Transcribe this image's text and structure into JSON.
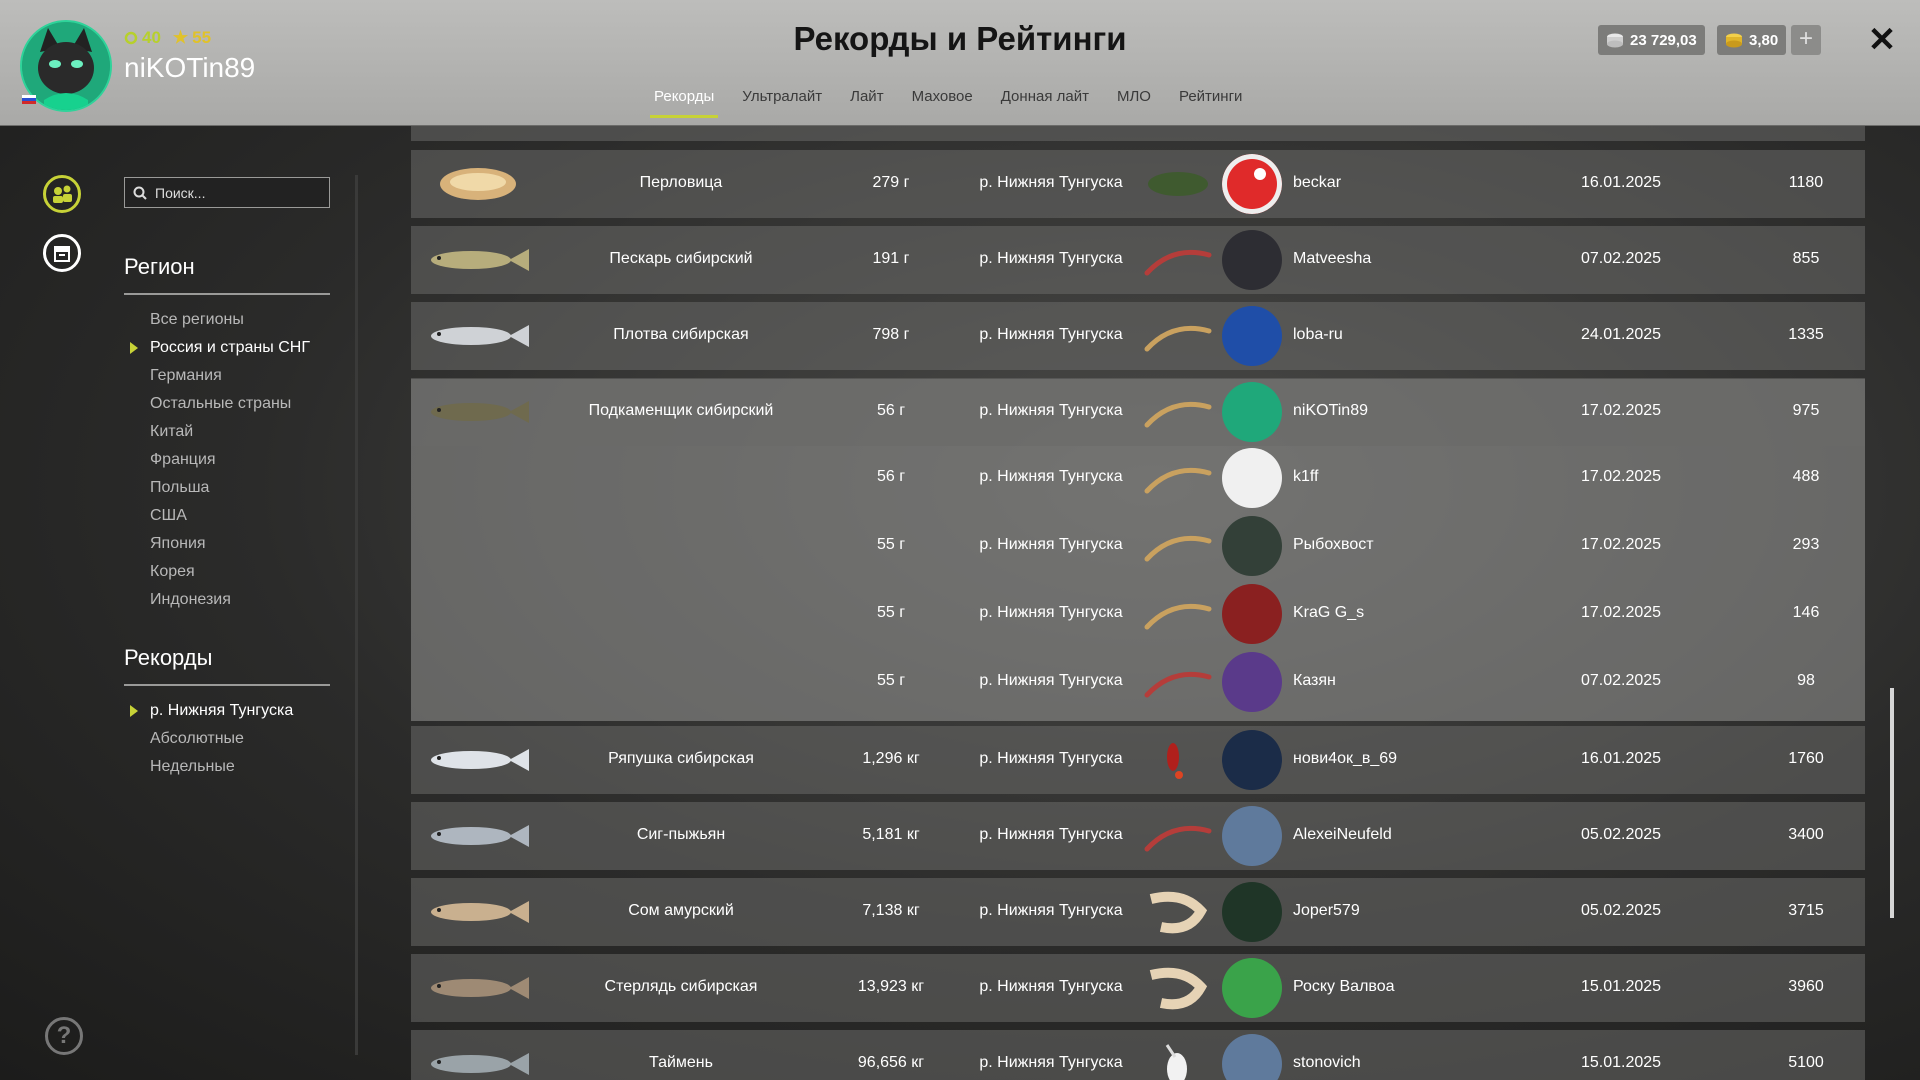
{
  "header": {
    "title": "Рекорды и Рейтинги",
    "username": "niKOTin89",
    "level": "40",
    "stars": "55",
    "silver": "23 729,03",
    "gold": "3,80",
    "plus": "+",
    "close": "✕",
    "tabs": [
      "Рекорды",
      "Ультралайт",
      "Лайт",
      "Маховое",
      "Донная лайт",
      "МЛО",
      "Рейтинги"
    ],
    "active_tab": "Рекорды"
  },
  "sidebar": {
    "search_placeholder": "Поиск...",
    "region_title": "Регион",
    "regions": [
      "Все регионы",
      "Россия и страны СНГ",
      "Германия",
      "Остальные страны",
      "Китай",
      "Франция",
      "Польша",
      "США",
      "Япония",
      "Корея",
      "Индонезия"
    ],
    "selected_region": "Россия и страны СНГ",
    "records_title": "Рекорды",
    "records": [
      "р. Нижняя Тунгуска",
      "Абсолютные",
      "Недельные"
    ],
    "selected_record": "р. Нижняя Тунгуска",
    "help": "?"
  },
  "rows": [
    {
      "fish": "Перловица",
      "weight": "279 г",
      "location": "р. Нижняя Тунгуска",
      "user": "beckar",
      "date": "16.01.2025",
      "points": "1180",
      "fish_icon": "mussel",
      "bait_icon": "groundbait",
      "avatar": "red-ball"
    },
    {
      "fish": "Пескарь сибирский",
      "weight": "191 г",
      "location": "р. Нижняя Тунгуска",
      "user": "Matveesha",
      "date": "07.02.2025",
      "points": "855",
      "fish_icon": "gudgeon",
      "bait_icon": "worm",
      "avatar": "dark"
    },
    {
      "fish": "Плотва сибирская",
      "weight": "798 г",
      "location": "р. Нижняя Тунгуска",
      "user": "loba-ru",
      "date": "24.01.2025",
      "points": "1335",
      "fish_icon": "roach",
      "bait_icon": "maggot",
      "avatar": "blue-wolf"
    },
    {
      "fish": "Подкаменщик сибирский",
      "weight": "56 г",
      "location": "р. Нижняя Тунгуска",
      "user": "niKOTin89",
      "date": "17.02.2025",
      "points": "975",
      "fish_icon": "sculpin",
      "bait_icon": "maggot",
      "avatar": "green-cat"
    },
    {
      "fish": "",
      "weight": "56 г",
      "location": "р. Нижняя Тунгуска",
      "user": "k1ff",
      "date": "17.02.2025",
      "points": "488",
      "fish_icon": "",
      "bait_icon": "maggot",
      "avatar": "white-ghost"
    },
    {
      "fish": "",
      "weight": "55 г",
      "location": "р. Нижняя Тунгуска",
      "user": "Рыбохвост",
      "date": "17.02.2025",
      "points": "293",
      "fish_icon": "",
      "bait_icon": "maggot",
      "avatar": "fish-dark"
    },
    {
      "fish": "",
      "weight": "55 г",
      "location": "р. Нижняя Тунгуска",
      "user": "KraG G_s",
      "date": "17.02.2025",
      "points": "146",
      "fish_icon": "",
      "bait_icon": "maggot",
      "avatar": "red-logo"
    },
    {
      "fish": "",
      "weight": "55 г",
      "location": "р. Нижняя Тунгуска",
      "user": "Казян",
      "date": "07.02.2025",
      "points": "98",
      "fish_icon": "",
      "bait_icon": "worm",
      "avatar": "purple-logo"
    },
    {
      "fish": "Ряпушка сибирская",
      "weight": "1,296 кг",
      "location": "р. Нижняя Тунгуска",
      "user": "нови4ок_в_69",
      "date": "16.01.2025",
      "points": "1760",
      "fish_icon": "vendace",
      "bait_icon": "spoon-lure",
      "avatar": "blue-emblem"
    },
    {
      "fish": "Сиг-пыжьян",
      "weight": "5,181 кг",
      "location": "р. Нижняя Тунгуска",
      "user": "AlexeiNeufeld",
      "date": "05.02.2025",
      "points": "3400",
      "fish_icon": "whitefish",
      "bait_icon": "worm",
      "avatar": "cartoon-man"
    },
    {
      "fish": "Сом амурский",
      "weight": "7,138 кг",
      "location": "р. Нижняя Тунгуска",
      "user": "Joper579",
      "date": "05.02.2025",
      "points": "3715",
      "fish_icon": "catfish",
      "bait_icon": "shrimp",
      "avatar": "joper-logo"
    },
    {
      "fish": "Стерлядь сибирская",
      "weight": "13,923 кг",
      "location": "р. Нижняя Тунгуска",
      "user": "Роску Валвоа",
      "date": "15.01.2025",
      "points": "3960",
      "fish_icon": "sterlet",
      "bait_icon": "shrimp",
      "avatar": "green-fox"
    },
    {
      "fish": "Таймень",
      "weight": "96,656 кг",
      "location": "р. Нижняя Тунгуска",
      "user": "stonovich",
      "date": "15.01.2025",
      "points": "5100",
      "fish_icon": "taimen",
      "bait_icon": "mouse-lure",
      "avatar": "cartoon-man"
    }
  ]
}
